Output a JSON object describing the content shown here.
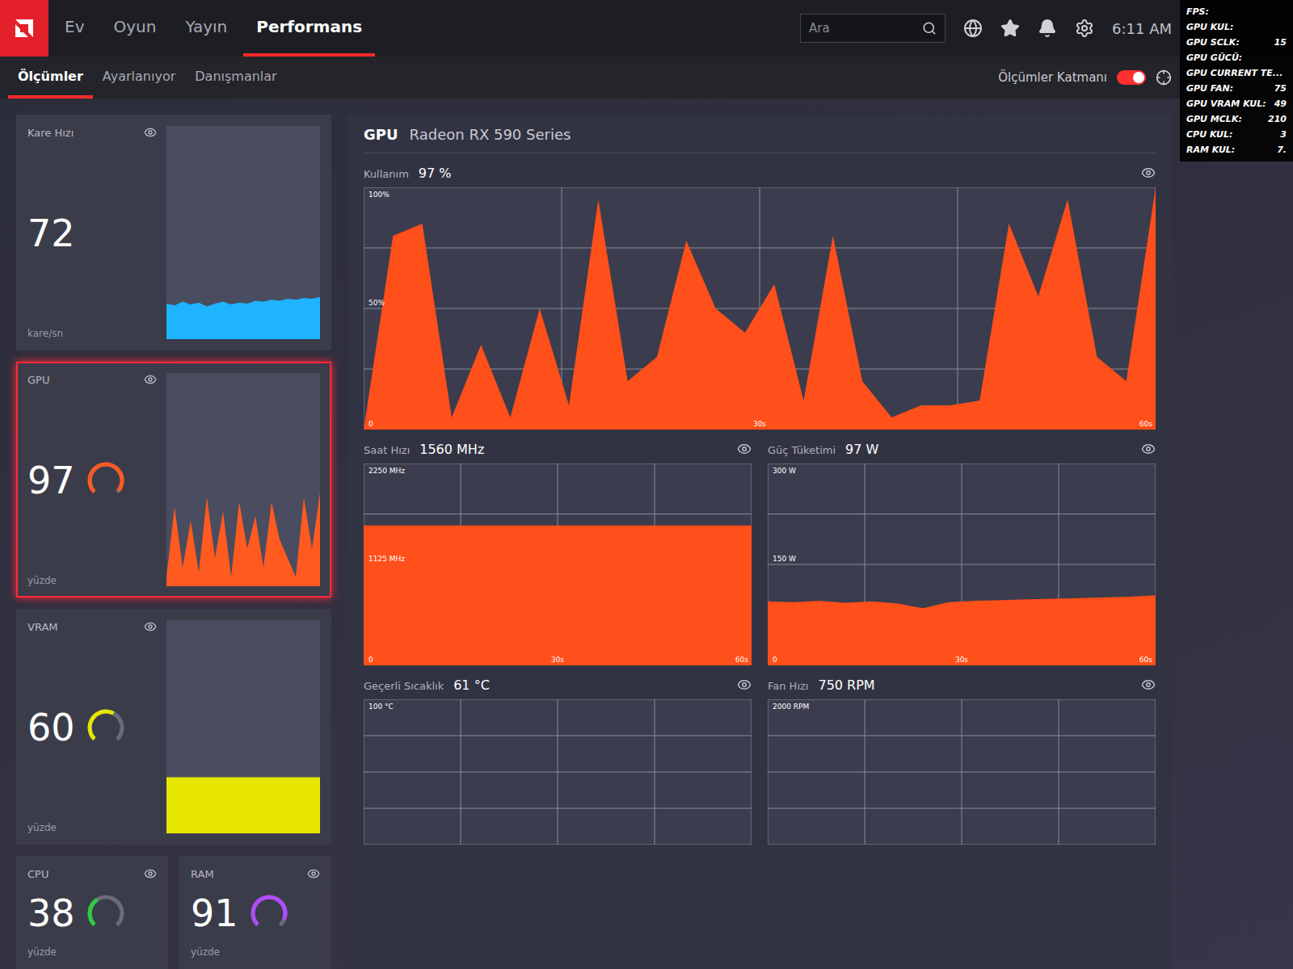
{
  "nav": {
    "tabs": [
      {
        "label": "Ev",
        "selected": false
      },
      {
        "label": "Oyun",
        "selected": false
      },
      {
        "label": "Yayın",
        "selected": false
      },
      {
        "label": "Performans",
        "selected": true
      }
    ],
    "search": {
      "placeholder": "Ara"
    },
    "time": "6:11 AM"
  },
  "subnav": {
    "tabs": [
      {
        "label": "Ölçümler",
        "selected": true
      },
      {
        "label": "Ayarlanıyor",
        "selected": false
      },
      {
        "label": "Danışmanlar",
        "selected": false
      }
    ],
    "overlay_toggle": {
      "label": "Ölçümler Katmanı",
      "on": true
    }
  },
  "cards": [
    {
      "title": "Kare Hızı",
      "value": "72",
      "unit": "kare/sn",
      "kind": "sparkline",
      "selected": false,
      "color": "#1eb4ff",
      "spark": [
        0.38,
        0.36,
        0.4,
        0.37,
        0.39,
        0.35,
        0.38,
        0.4,
        0.37,
        0.39,
        0.38,
        0.41,
        0.4,
        0.42,
        0.41,
        0.43,
        0.42,
        0.44,
        0.43,
        0.45
      ]
    },
    {
      "title": "GPU",
      "value": "97",
      "unit": "yüzde",
      "kind": "gauge-sparkline",
      "selected": true,
      "level": 0.97,
      "color": "#ff5a1f",
      "spark": [
        0.1,
        0.85,
        0.2,
        0.7,
        0.15,
        0.95,
        0.3,
        0.8,
        0.1,
        0.9,
        0.4,
        0.75,
        0.2,
        0.9,
        0.5,
        0.3,
        0.1,
        0.95,
        0.4,
        1.0
      ]
    },
    {
      "title": "VRAM",
      "value": "60",
      "unit": "yüzde",
      "kind": "gauge-sparkline",
      "selected": false,
      "level": 0.6,
      "color": "#e6e600",
      "spark": [
        0.6,
        0.6,
        0.6,
        0.6,
        0.6,
        0.6,
        0.6,
        0.6,
        0.6,
        0.6,
        0.6,
        0.6
      ]
    },
    {
      "title": "CPU",
      "value": "38",
      "unit": "yüzde",
      "kind": "gauge",
      "selected": false,
      "level": 0.38,
      "color": "#2ecc40"
    },
    {
      "title": "RAM",
      "value": "91",
      "unit": "yüzde",
      "kind": "gauge",
      "selected": false,
      "level": 0.91,
      "color": "#b04cff"
    }
  ],
  "gpu_panel": {
    "label": "GPU",
    "name": "Radeon RX 590 Series",
    "usage_chart": {
      "title": "Kullanım",
      "reading": "97 %",
      "max": 100,
      "y_ticks": [
        "100%",
        "50%",
        "0"
      ],
      "x_ticks": [
        "30s",
        "60s"
      ],
      "series": [
        0,
        80,
        85,
        5,
        35,
        5,
        50,
        10,
        95,
        20,
        30,
        78,
        50,
        40,
        60,
        12,
        80,
        20,
        5,
        10,
        10,
        12,
        85,
        55,
        95,
        30,
        20,
        100
      ]
    },
    "charts": [
      {
        "title": "Saat Hızı",
        "reading": "1560 MHz",
        "max": 2250,
        "y_ticks": [
          "2250 MHz",
          "1125 MHz",
          "0"
        ],
        "x_ticks": [
          "30s",
          "60s"
        ],
        "series": [
          1560,
          1560,
          1560,
          1560,
          1560,
          1560,
          1560,
          1560,
          1560,
          1560,
          1560,
          1560
        ]
      },
      {
        "title": "Güç Tüketimi",
        "reading": "97 W",
        "max": 300,
        "y_ticks": [
          "300 W",
          "150 W",
          "0"
        ],
        "x_ticks": [
          "30s",
          "60s"
        ],
        "series": [
          95,
          94,
          96,
          93,
          95,
          92,
          85,
          94,
          96,
          97,
          98,
          99,
          100,
          101,
          102,
          104
        ]
      },
      {
        "title": "Geçerli Sıcaklık",
        "reading": "61 °C",
        "max": 100,
        "y_ticks": [
          "100 °C"
        ],
        "x_ticks": [],
        "series": []
      },
      {
        "title": "Fan Hızı",
        "reading": "750 RPM",
        "max": 2000,
        "y_ticks": [
          "2000 RPM"
        ],
        "x_ticks": [],
        "series": []
      }
    ]
  },
  "metrics_overlay": [
    {
      "label": "FPS:"
    },
    {
      "label": "GPU KUL:"
    },
    {
      "label": "GPU SCLK:",
      "value": "15"
    },
    {
      "label": "GPU GÜCÜ:"
    },
    {
      "label": "GPU CURRENT TE..."
    },
    {
      "label": "GPU FAN:",
      "value": "75"
    },
    {
      "label": "GPU VRAM KUL:",
      "value": "49"
    },
    {
      "label": "GPU MCLK:",
      "value": "210"
    },
    {
      "label": "CPU KUL:",
      "value": "3"
    },
    {
      "label": "RAM KUL:",
      "value": "7."
    }
  ]
}
